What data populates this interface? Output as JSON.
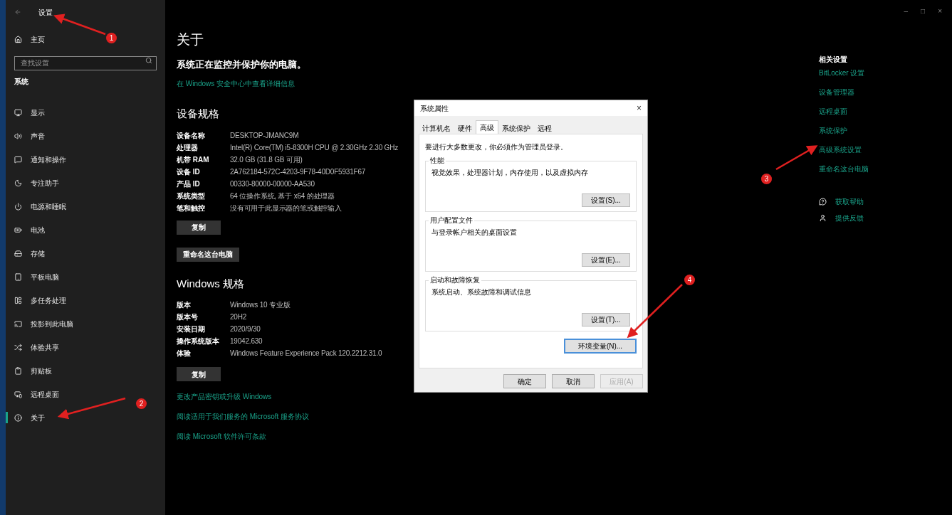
{
  "window": {
    "title": "设置",
    "controls": [
      "–",
      "□",
      "×"
    ]
  },
  "sidebar": {
    "home": "主页",
    "search": {
      "placeholder": "查找设置"
    },
    "section": "系统",
    "items": [
      {
        "label": "显示",
        "selected": false
      },
      {
        "label": "声音",
        "selected": false
      },
      {
        "label": "通知和操作",
        "selected": false
      },
      {
        "label": "专注助手",
        "selected": false
      },
      {
        "label": "电源和睡眠",
        "selected": false
      },
      {
        "label": "电池",
        "selected": false
      },
      {
        "label": "存储",
        "selected": false
      },
      {
        "label": "平板电脑",
        "selected": false
      },
      {
        "label": "多任务处理",
        "selected": false
      },
      {
        "label": "投影到此电脑",
        "selected": false
      },
      {
        "label": "体验共享",
        "selected": false
      },
      {
        "label": "剪贴板",
        "selected": false
      },
      {
        "label": "远程桌面",
        "selected": false
      },
      {
        "label": "关于",
        "selected": true
      }
    ]
  },
  "main": {
    "title": "关于",
    "status": "系统正在监控并保护你的电脑。",
    "security_link": "在 Windows 安全中心中查看详细信息",
    "device_specs": {
      "heading": "设备规格",
      "rows": [
        {
          "label": "设备名称",
          "value": "DESKTOP-JMANC9M"
        },
        {
          "label": "处理器",
          "value": "Intel(R) Core(TM) i5-8300H CPU @ 2.30GHz   2.30 GHz"
        },
        {
          "label": "机带 RAM",
          "value": "32.0 GB (31.8 GB 可用)"
        },
        {
          "label": "设备 ID",
          "value": "2A762184-572C-4203-9F78-40D0F5931F67"
        },
        {
          "label": "产品 ID",
          "value": "00330-80000-00000-AA530"
        },
        {
          "label": "系统类型",
          "value": "64 位操作系统, 基于 x64 的处理器"
        },
        {
          "label": "笔和触控",
          "value": "没有可用于此显示器的笔或触控输入"
        }
      ],
      "copy_button": "复制",
      "rename_button": "重命名这台电脑"
    },
    "windows_specs": {
      "heading": "Windows 规格",
      "rows": [
        {
          "label": "版本",
          "value": "Windows 10 专业版"
        },
        {
          "label": "版本号",
          "value": "20H2"
        },
        {
          "label": "安装日期",
          "value": "2020/9/30"
        },
        {
          "label": "操作系统版本",
          "value": "19042.630"
        },
        {
          "label": "体验",
          "value": "Windows Feature Experience Pack 120.2212.31.0"
        }
      ],
      "copy_button": "复制"
    },
    "links": [
      "更改产品密钥或升级 Windows",
      "阅读适用于我们服务的 Microsoft 服务协议",
      "阅读 Microsoft 软件许可条款"
    ]
  },
  "related": {
    "heading": "相关设置",
    "links": [
      "BitLocker 设置",
      "设备管理器",
      "远程桌面",
      "系统保护",
      "高级系统设置",
      "重命名这台电脑"
    ],
    "help": [
      "获取帮助",
      "提供反馈"
    ]
  },
  "dialog": {
    "title": "系统属性",
    "close": "×",
    "tabs": [
      {
        "label": "计算机名",
        "selected": false
      },
      {
        "label": "硬件",
        "selected": false
      },
      {
        "label": "高级",
        "selected": true
      },
      {
        "label": "系统保护",
        "selected": false
      },
      {
        "label": "远程",
        "selected": false
      }
    ],
    "notice": "要进行大多数更改，你必须作为管理员登录。",
    "groups": [
      {
        "title": "性能",
        "description": "视觉效果，处理器计划，内存使用，以及虚拟内存",
        "button": "设置(S)..."
      },
      {
        "title": "用户配置文件",
        "description": "与登录帐户相关的桌面设置",
        "button": "设置(E)..."
      },
      {
        "title": "启动和故障恢复",
        "description": "系统启动、系统故障和调试信息",
        "button": "设置(T)..."
      }
    ],
    "env_button": "环境变量(N)...",
    "footer": [
      {
        "label": "确定",
        "disabled": false
      },
      {
        "label": "取消",
        "disabled": false
      },
      {
        "label": "应用(A)",
        "disabled": true
      }
    ]
  },
  "annotations": [
    "1",
    "2",
    "3",
    "4"
  ]
}
